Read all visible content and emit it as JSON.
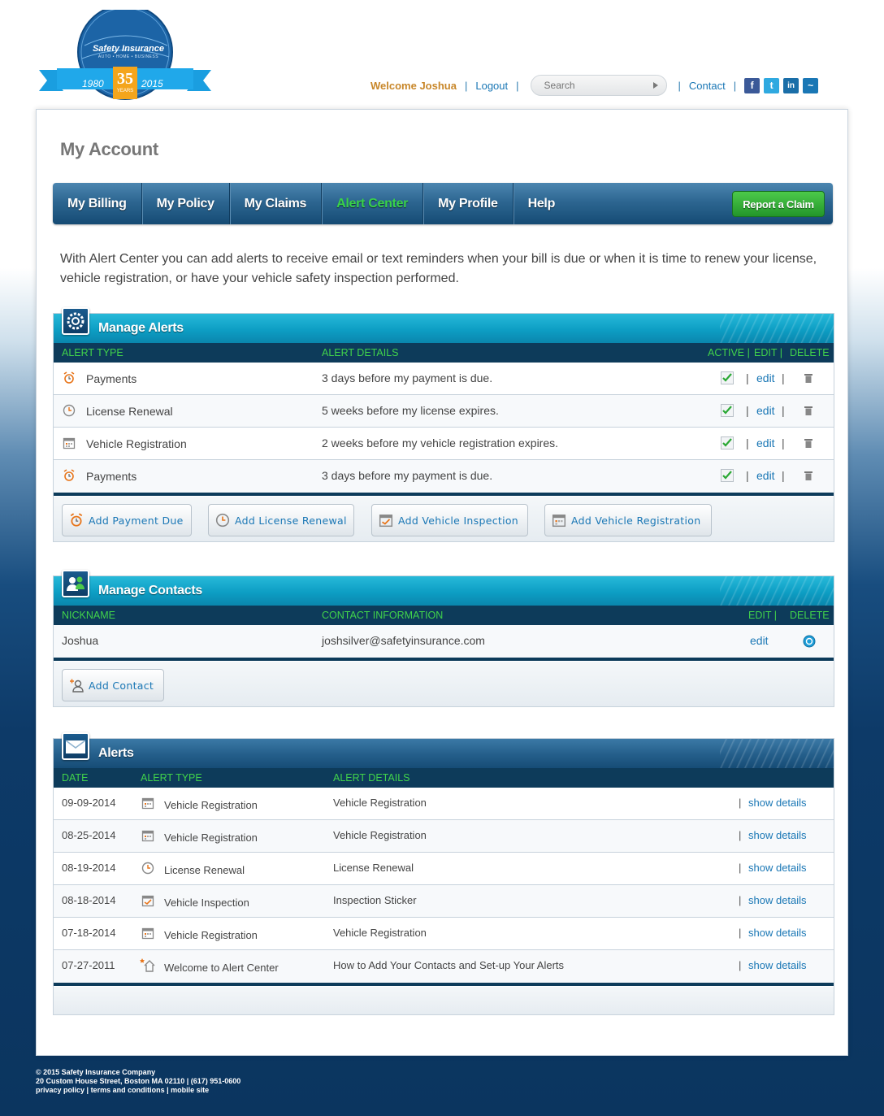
{
  "logo": {
    "brand": "Safety Insurance",
    "tagline": "AUTO • HOME • BUSINESS",
    "year_start": "1980",
    "anniversary": "35",
    "anniversary_sub": "YEARS",
    "year_end": "2015"
  },
  "topnav": {
    "welcome": "Welcome Joshua",
    "logout": "Logout",
    "search_placeholder": "Search",
    "contact": "Contact"
  },
  "social": [
    {
      "icon": "facebook-icon",
      "glyph": "f",
      "color": "#3b5998"
    },
    {
      "icon": "twitter-icon",
      "glyph": "t",
      "color": "#2fa9e0"
    },
    {
      "icon": "linkedin-icon",
      "glyph": "in",
      "color": "#1a6ea8"
    },
    {
      "icon": "safety-app-icon",
      "glyph": "~",
      "color": "#1a77b5"
    }
  ],
  "page_title": "My Account",
  "tabs": [
    "My Billing",
    "My Policy",
    "My Claims",
    "Alert Center",
    "My Profile",
    "Help"
  ],
  "active_tab": "Alert Center",
  "report_claim": "Report a Claim",
  "intro": "With Alert Center you can add alerts to receive email or text reminders when your bill is due or when it is time to renew your license, vehicle registration, or have your vehicle safety inspection performed.",
  "manage_alerts": {
    "title": "Manage Alerts",
    "columns": {
      "type": "ALERT TYPE",
      "details": "ALERT DETAILS",
      "active": "ACTIVE |",
      "edit": "EDIT |",
      "delete": "DELETE"
    },
    "rows": [
      {
        "icon": "alarm-clock-icon",
        "type": "Payments",
        "details": "3 days before my payment is due.",
        "edit": "edit"
      },
      {
        "icon": "clock-icon",
        "type": "License Renewal",
        "details": "5 weeks before my license expires.",
        "edit": "edit"
      },
      {
        "icon": "calendar-icon",
        "type": "Vehicle Registration",
        "details": "2 weeks before my vehicle registration expires.",
        "edit": "edit"
      },
      {
        "icon": "alarm-clock-icon",
        "type": "Payments",
        "details": "3 days before my payment is due.",
        "edit": "edit"
      }
    ],
    "buttons": [
      "Add Payment Due",
      "Add License Renewal",
      "Add Vehicle Inspection",
      "Add Vehicle Registration"
    ]
  },
  "manage_contacts": {
    "title": "Manage Contacts",
    "columns": {
      "nickname": "NICKNAME",
      "info": "CONTACT INFORMATION",
      "edit": "EDIT |",
      "delete": "DELETE"
    },
    "rows": [
      {
        "nickname": "Joshua",
        "info": "joshsilver@safetyinsurance.com",
        "edit": "edit"
      }
    ],
    "add_button": "Add Contact"
  },
  "alerts": {
    "title": "Alerts",
    "columns": {
      "date": "DATE",
      "type": "ALERT TYPE",
      "details": "ALERT DETAILS"
    },
    "rows": [
      {
        "date": "09-09-2014",
        "icon": "calendar-icon",
        "type": "Vehicle Registration",
        "details": "Vehicle Registration",
        "action": "show details"
      },
      {
        "date": "08-25-2014",
        "icon": "calendar-icon",
        "type": "Vehicle Registration",
        "details": "Vehicle Registration",
        "action": "show details"
      },
      {
        "date": "08-19-2014",
        "icon": "clock-icon",
        "type": "License Renewal",
        "details": "License Renewal",
        "action": "show details"
      },
      {
        "date": "08-18-2014",
        "icon": "calendar-check-icon",
        "type": "Vehicle Inspection",
        "details": "Inspection Sticker",
        "action": "show details"
      },
      {
        "date": "07-18-2014",
        "icon": "calendar-icon",
        "type": "Vehicle Registration",
        "details": "Vehicle Registration",
        "action": "show details"
      },
      {
        "date": "07-27-2011",
        "icon": "home-star-icon",
        "type": "Welcome to Alert Center",
        "details": "How to Add Your Contacts and Set-up Your Alerts",
        "action": "show details"
      }
    ]
  },
  "footer": {
    "copyright": "© 2015 Safety Insurance Company",
    "address": "20 Custom House Street, Boston MA 02110 | (617) 951-0600",
    "privacy": "privacy policy",
    "terms": "terms and conditions",
    "mobile": "mobile site"
  },
  "colors": {
    "accent_green": "#41d34b",
    "link_blue": "#1a77b5",
    "header_teal": "#0d9ec4",
    "navy": "#0d3b5a",
    "welcome_orange": "#c8872a"
  }
}
